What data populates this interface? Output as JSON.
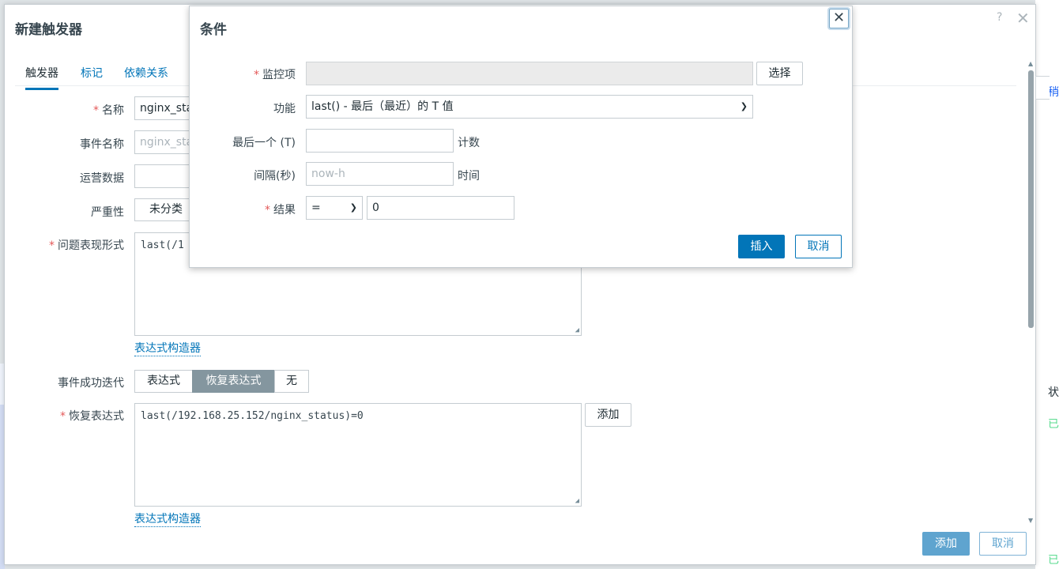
{
  "background": {
    "right_chars": [
      "稍",
      "状",
      "已",
      "已"
    ]
  },
  "trigger_dialog": {
    "title": "新建触发器",
    "help": "?",
    "close": "✕",
    "tabs": [
      "触发器",
      "标记",
      "依赖关系"
    ],
    "fields": {
      "name_label": "名称",
      "name_value": "nginx_sta",
      "event_name_label": "事件名称",
      "event_name_placeholder": "nginx_sta",
      "opdata_label": "运营数据",
      "opdata_value": "",
      "severity_label": "严重性",
      "severity_value": "未分类",
      "problem_expr_label": "问题表现形式",
      "problem_expr_value": "last(/1",
      "expr_builder_link": "表达式构造器",
      "ok_event_label": "事件成功迭代",
      "ok_event_options": [
        "表达式",
        "恢复表达式",
        "无"
      ],
      "ok_event_selected": "恢复表达式",
      "recovery_expr_label": "恢复表达式",
      "recovery_expr_value": "last(/192.168.25.152/nginx_status)=0",
      "recovery_add_button": "添加",
      "recovery_builder_link": "表达式构造器"
    },
    "footer": {
      "add_button": "添加",
      "cancel_button": "取消"
    }
  },
  "condition_dialog": {
    "title": "条件",
    "close": "✕",
    "item_label": "监控项",
    "item_value": "",
    "select_button": "选择",
    "function_label": "功能",
    "function_value": "last() - 最后（最近）的 T 值",
    "last_t_label": "最后一个 (T)",
    "last_t_value": "",
    "last_t_suffix": "计数",
    "interval_label": "间隔(秒)",
    "interval_placeholder": "now-h",
    "interval_suffix": "时间",
    "result_label": "结果",
    "result_operator": "=",
    "result_value": "0",
    "insert_button": "插入",
    "cancel_button": "取消"
  }
}
